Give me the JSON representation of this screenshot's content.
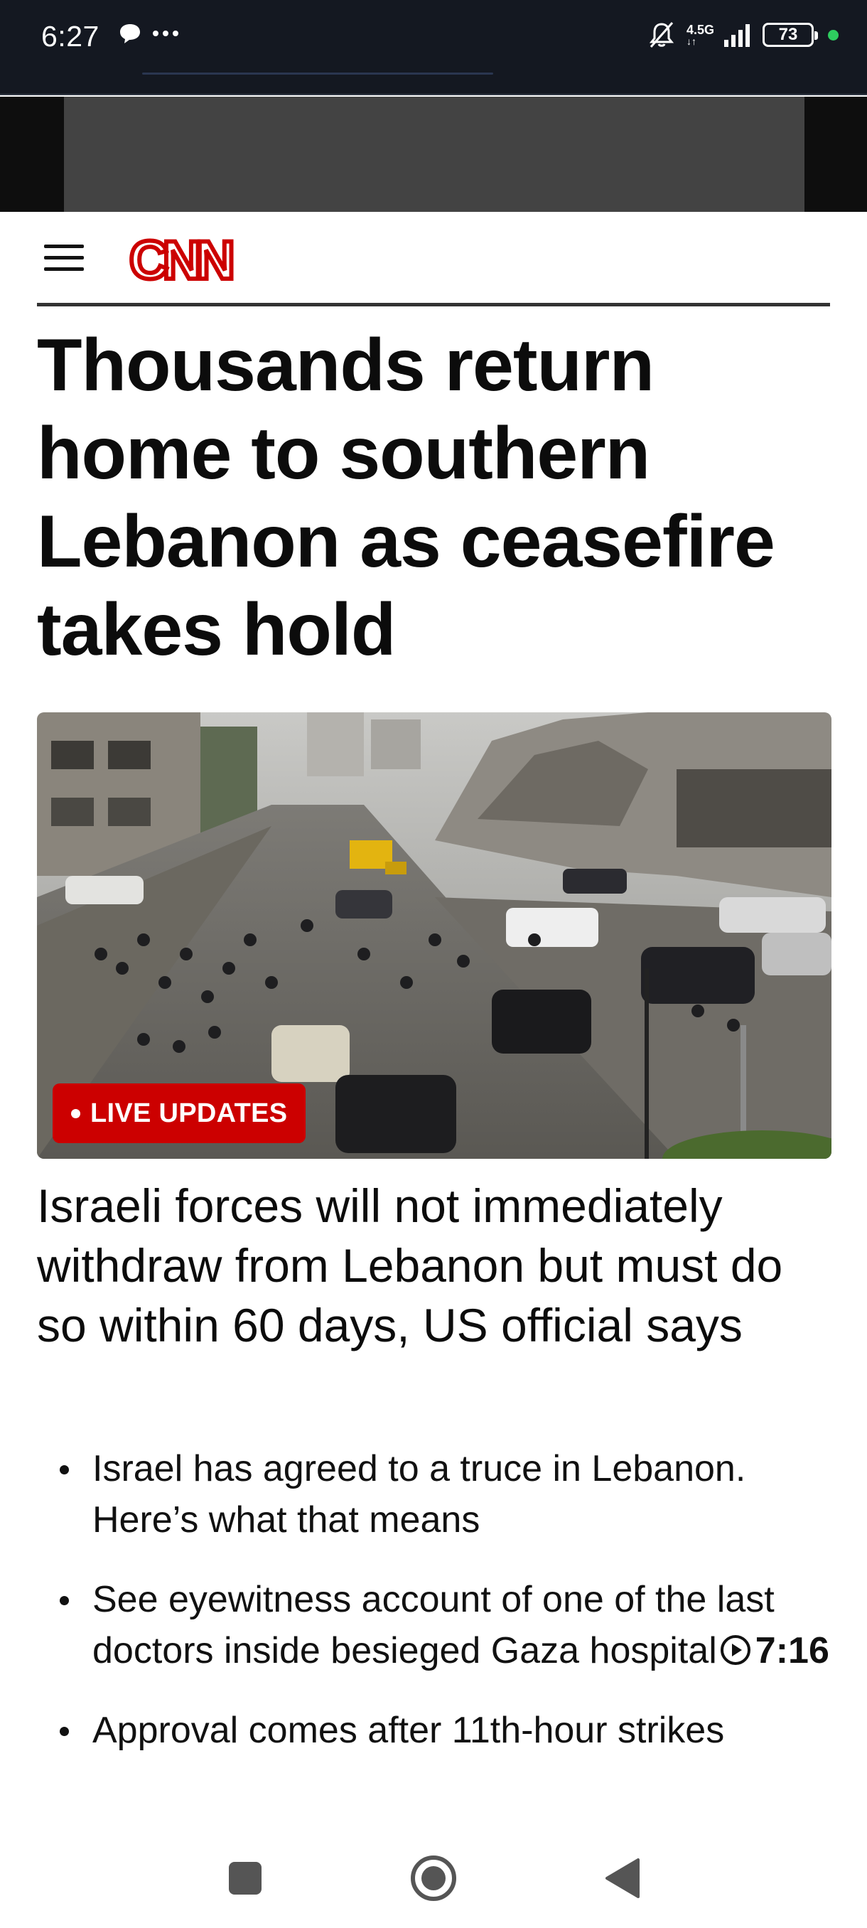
{
  "status_bar": {
    "time": "6:27",
    "network": "4.5G",
    "battery": "73",
    "icons": [
      "chat-bubble-icon",
      "more-dots-icon",
      "mute-bell-icon",
      "signal-icon",
      "battery-icon",
      "status-dot-icon"
    ]
  },
  "header": {
    "logo_text": "CNN",
    "brand_color": "#cc0000",
    "menu_icon": "hamburger-menu-icon"
  },
  "article": {
    "headline": "Thousands return home to southern Lebanon as ceasefire takes hold",
    "badge": "LIVE UPDATES",
    "subheadline": "Israeli forces will not immediately withdraw from Lebanon but must do so within 60 days, US official says",
    "bullets": [
      {
        "text": "Israel has agreed to a truce in Lebanon. Here’s what that means"
      },
      {
        "text": "See eyewitness account of one of the last doctors inside besieged Gaza hospital",
        "duration": "7:16"
      },
      {
        "text": "Approval comes after 11th-hour strikes"
      }
    ]
  },
  "nav_bar": {
    "buttons": [
      "recents-square-icon",
      "home-circle-icon",
      "back-triangle-icon"
    ]
  }
}
